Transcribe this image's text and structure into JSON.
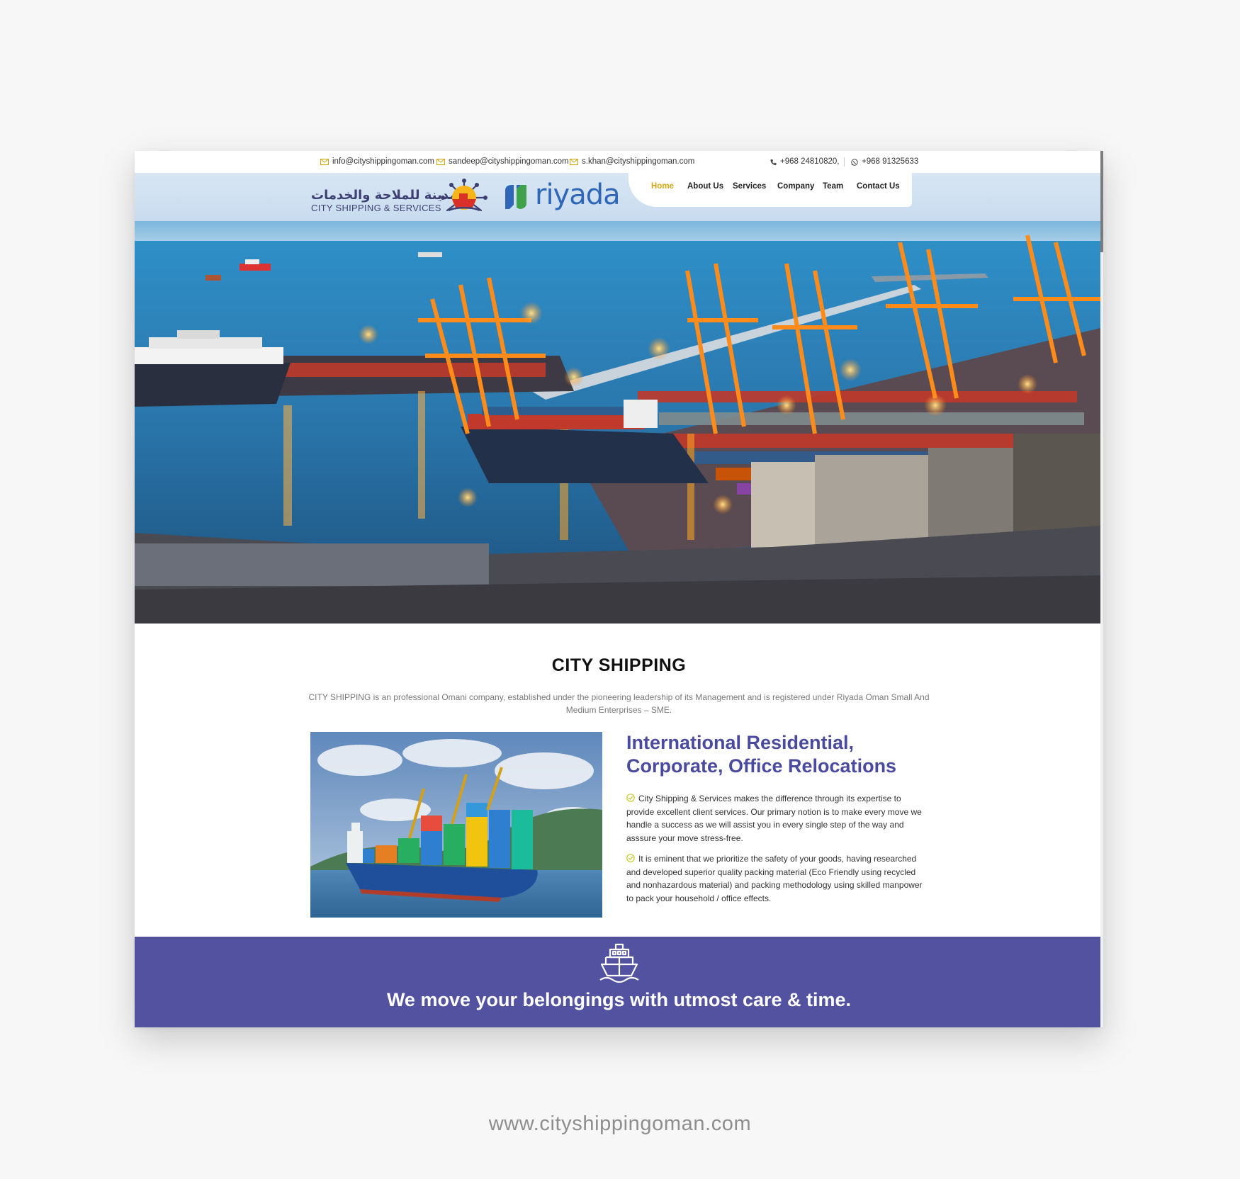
{
  "topbar": {
    "emails": [
      "info@cityshippingoman.com",
      "sandeep@cityshippingoman.com",
      "s.khan@cityshippingoman.com"
    ],
    "phone": "+968 24810820,",
    "whatsapp": "+968 91325633"
  },
  "logo": {
    "arabic_name": "المدينة للملاحة والخدمات",
    "english_name": "CITY SHIPPING & SERVICES",
    "partner_name": "riyada"
  },
  "nav": {
    "items": [
      "Home",
      "About Us",
      "Services",
      "Company",
      "Team",
      "Contact Us"
    ],
    "active": "Home"
  },
  "intro": {
    "title": "CITY SHIPPING",
    "text": "CITY SHIPPING is an professional Omani company, established under the pioneering leadership of its Management and is registered under Riyada Oman Small And Medium Enterprises – SME."
  },
  "feature": {
    "heading_line1": "International Residential,",
    "heading_line2": "Corporate, Office Relocations",
    "para1": "City Shipping & Services makes the difference through its expertise to provide excellent client services. Our primary notion is to make every move we handle a success as we will assist you in every single step of the way and asssure your move stress-free.",
    "para2": "It is eminent that we prioritize the safety of your goods, having researched and developed superior quality packing material (Eco Friendly using recycled and nonhazardous material) and packing methodology using skilled manpower to pack your household / office effects."
  },
  "banner": {
    "tagline": "We move your belongings with utmost care & time.",
    "icon": "ship-icon"
  },
  "site_url": "www.cityshippingoman.com",
  "colors": {
    "accent": "#d1a714",
    "brand_purple": "#5252a1",
    "heading_purple": "#4a4aa0",
    "riyada_blue": "#2f66b8"
  }
}
